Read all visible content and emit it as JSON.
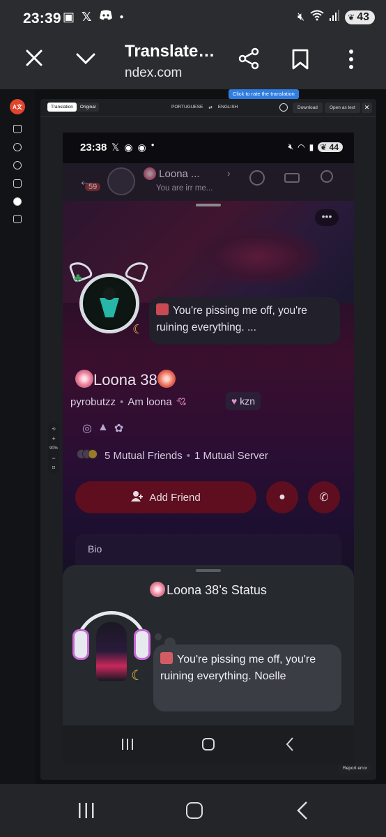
{
  "status_bar": {
    "time": "23:39",
    "battery": "43"
  },
  "toolbar": {
    "title": "Translate…",
    "url": "ndex.com"
  },
  "page": {
    "tooltip": "Click to rate the translation",
    "tabs": [
      "Translation",
      "Original"
    ],
    "source_lang": "PORTUGUESE",
    "target_lang": "ENGLISH",
    "download_label": "Download",
    "open_text_label": "Open as text",
    "zoom_level": "90%",
    "report_label": "Report error"
  },
  "shot": {
    "status": {
      "time": "23:38",
      "battery": "44"
    },
    "header": {
      "name": "Loona ...",
      "subtitle": "You are irr me...",
      "badge": "59"
    },
    "status_preview": "You're pissing me off, you're ruining everything. ...",
    "display_name": "Loona 38",
    "username": "pyrobutzz",
    "pronouns": "Am loona",
    "tag": "kzn",
    "mutual_friends": "5 Mutual Friends",
    "mutual_servers": "1 Mutual Server",
    "add_friend_label": "Add Friend",
    "bio_label": "Bio",
    "sheet": {
      "title": "Loona 38’s Status",
      "status_text": "You're pissing me off, you're ruining everything. Noelle"
    }
  }
}
